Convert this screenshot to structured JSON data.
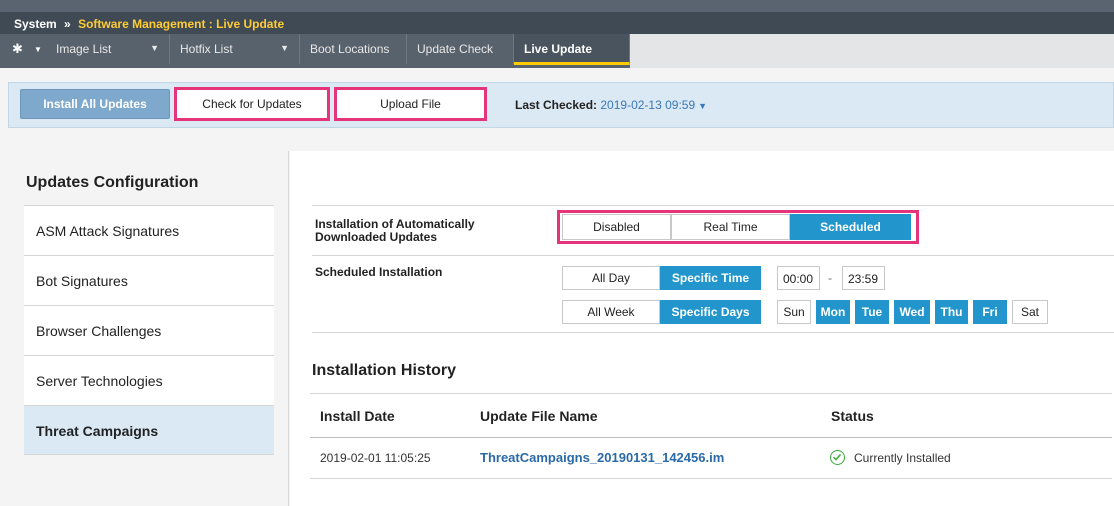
{
  "breadcrumb": {
    "root": "System",
    "separator": "»",
    "path": "Software Management : Live Update"
  },
  "tabs": [
    {
      "label": "Image List"
    },
    {
      "label": "Hotfix List"
    },
    {
      "label": "Boot Locations"
    },
    {
      "label": "Update Check"
    },
    {
      "label": "Live Update"
    }
  ],
  "actions": {
    "install_all": "Install All Updates",
    "check_updates": "Check for Updates",
    "upload_file": "Upload File",
    "last_checked_label": "Last Checked:",
    "last_checked_value": "2019-02-13 09:59"
  },
  "sidebar": {
    "title": "Updates Configuration",
    "items": [
      {
        "label": "ASM Attack Signatures"
      },
      {
        "label": "Bot Signatures"
      },
      {
        "label": "Browser Challenges"
      },
      {
        "label": "Server Technologies"
      },
      {
        "label": "Threat Campaigns"
      }
    ],
    "active_index": 4
  },
  "config": {
    "auto_install_label": "Installation of Automatically Downloaded Updates",
    "auto_install_options": [
      "Disabled",
      "Real Time",
      "Scheduled"
    ],
    "auto_install_selected": "Scheduled",
    "scheduled_label": "Scheduled Installation",
    "time_options": [
      "All Day",
      "Specific Time"
    ],
    "time_selected": "Specific Time",
    "time_from": "00:00",
    "time_separator": "-",
    "time_to": "23:59",
    "week_options": [
      "All Week",
      "Specific Days"
    ],
    "week_selected": "Specific Days",
    "days": [
      {
        "label": "Sun",
        "on": false
      },
      {
        "label": "Mon",
        "on": true
      },
      {
        "label": "Tue",
        "on": true
      },
      {
        "label": "Wed",
        "on": true
      },
      {
        "label": "Thu",
        "on": true
      },
      {
        "label": "Fri",
        "on": true
      },
      {
        "label": "Sat",
        "on": false
      }
    ]
  },
  "history": {
    "title": "Installation History",
    "columns": [
      "Install Date",
      "Update File Name",
      "Status"
    ],
    "rows": [
      {
        "date": "2019-02-01 11:05:25",
        "file": "ThreatCampaigns_20190131_142456.im",
        "status": "Currently Installed"
      }
    ]
  },
  "colors": {
    "accent": "#2296cc",
    "highlight": "#e6347a",
    "brand_yellow": "#ffcc33"
  }
}
